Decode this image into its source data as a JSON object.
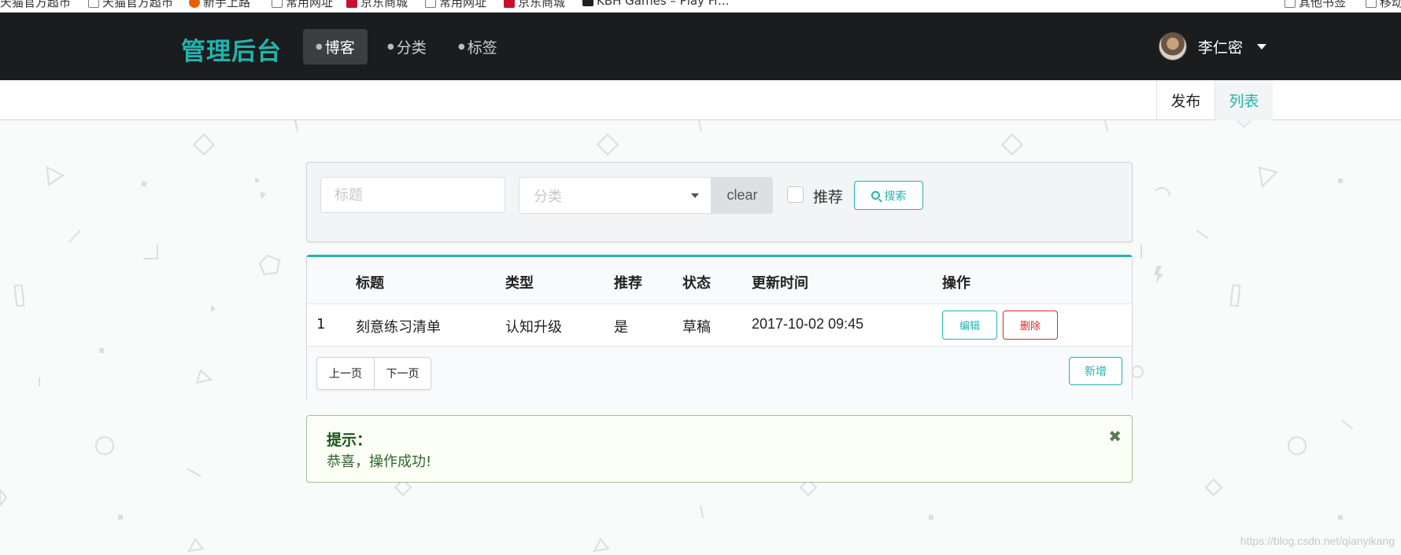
{
  "bookmarks": [
    "天猫官方超市",
    "天猫官方超市",
    "新手上路",
    "常用网址",
    "京东商城",
    "常用网址",
    "京东商城",
    "KBH Games – Play Fr...",
    "其他书签",
    "移动"
  ],
  "nav": {
    "brand": "管理后台",
    "items": [
      {
        "label": "博客",
        "active": true
      },
      {
        "label": "分类",
        "active": false
      },
      {
        "label": "标签",
        "active": false
      }
    ],
    "user_name": "李仁密"
  },
  "submenu": {
    "items": [
      {
        "label": "发布",
        "active": false
      },
      {
        "label": "列表",
        "active": true
      }
    ]
  },
  "search": {
    "title_placeholder": "标题",
    "category_placeholder": "分类",
    "clear_label": "clear",
    "recommend_label": "推荐",
    "recommend_checked": false,
    "search_label": "搜索"
  },
  "table": {
    "headers": [
      "",
      "标题",
      "类型",
      "推荐",
      "状态",
      "更新时间",
      "操作"
    ],
    "rows": [
      {
        "index": "1",
        "title": "刻意练习清单",
        "type": "认知升级",
        "recommend": "是",
        "status": "草稿",
        "updated": "2017-10-02 09:45",
        "edit_label": "编辑",
        "delete_label": "删除"
      }
    ],
    "prev_label": "上一页",
    "next_label": "下一页",
    "add_label": "新增"
  },
  "message": {
    "header": "提示：",
    "body": "恭喜，操作成功!",
    "color": "#2c662d"
  },
  "colors": {
    "accent": "#1fb5ad",
    "danger": "#db2828",
    "nav_bg": "#1b1c1d"
  },
  "watermark": "https://blog.csdn.net/qianyikang"
}
